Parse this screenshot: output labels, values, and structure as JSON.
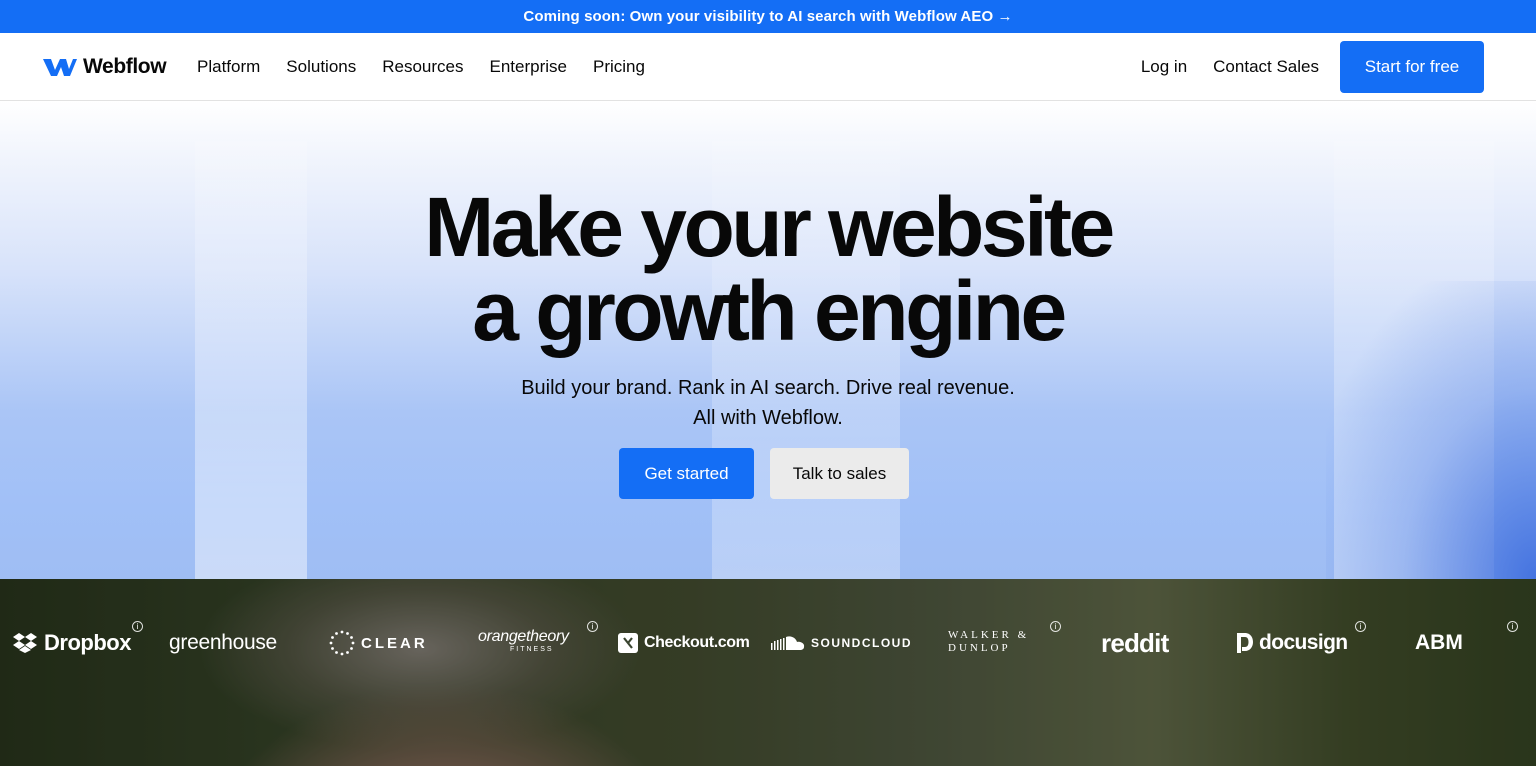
{
  "announcement": {
    "text": "Coming soon: Own your visibility to AI search with Webflow AEO →"
  },
  "nav": {
    "logo_text": "Webflow",
    "links": [
      "Platform",
      "Solutions",
      "Resources",
      "Enterprise",
      "Pricing"
    ],
    "login": "Log in",
    "contact": "Contact Sales",
    "cta": "Start for free"
  },
  "hero": {
    "title_line1": "Make your website",
    "title_line2": "a growth engine",
    "sub_line1": "Build your brand. Rank in AI search. Drive real revenue.",
    "sub_line2": "All with Webflow.",
    "primary_cta": "Get started",
    "secondary_cta": "Talk to sales"
  },
  "customers": [
    {
      "name": "Dropbox",
      "info": "i"
    },
    {
      "name": "greenhouse"
    },
    {
      "name": "CLEAR"
    },
    {
      "name": "orangetheory",
      "sub": "FITNESS",
      "info": "i"
    },
    {
      "name": "Checkout.com"
    },
    {
      "name": "SOUNDCLOUD"
    },
    {
      "name": "WALKER &",
      "name2": "DUNLOP",
      "info": "i"
    },
    {
      "name": "reddit"
    },
    {
      "name": "docusign",
      "info": "i"
    },
    {
      "name": "ABM",
      "info": "i"
    }
  ],
  "colors": {
    "brand_blue": "#146ef5",
    "text": "#080808",
    "secondary_btn": "#ebebeb"
  }
}
